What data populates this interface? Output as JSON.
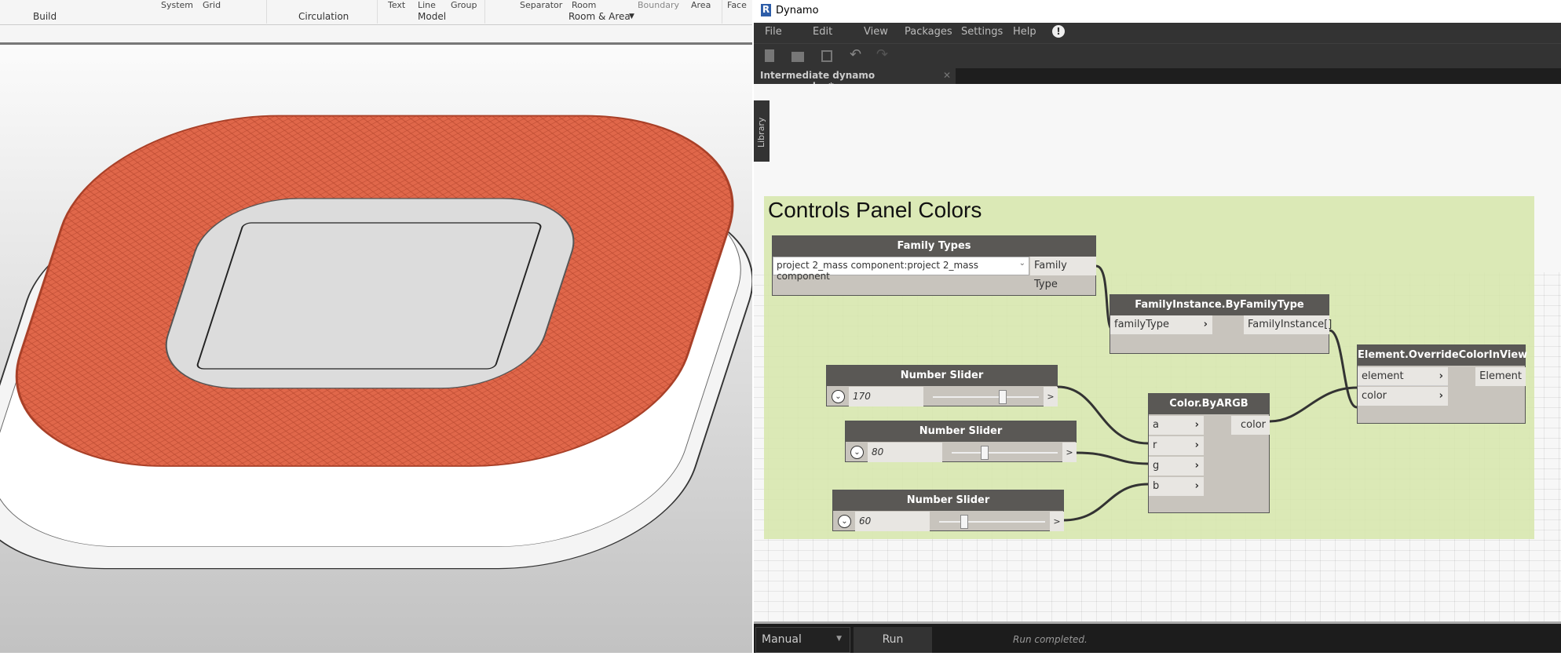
{
  "revit": {
    "ribbon_top": [
      "System",
      "Grid",
      "Text",
      "Line",
      "Group",
      "Separator",
      "Room",
      "Boundary",
      "Area",
      "Face"
    ],
    "panels": [
      "Build",
      "Circulation",
      "Model",
      "Room & Area"
    ],
    "model_color": "#e0674a"
  },
  "dynamo": {
    "title": "Dynamo",
    "menu": [
      "File",
      "Edit",
      "View",
      "Packages",
      "Settings",
      "Help"
    ],
    "toolbar_icons": [
      "new-file-icon",
      "open-icon",
      "save-icon",
      "undo-icon",
      "redo-icon"
    ],
    "tab": "Intermediate dynamo program.dyn*",
    "library": "Library",
    "group_title": "Controls Panel Colors",
    "group_color": "#d6e6aa",
    "nodes": {
      "family_types": {
        "title": "Family Types",
        "value": "project 2_mass component:project 2_mass component",
        "output": "Family Type"
      },
      "family_instance": {
        "title": "FamilyInstance.ByFamilyType",
        "input": "familyType",
        "output": "FamilyInstance[]"
      },
      "override": {
        "title": "Element.OverrideColorInView",
        "inputs": [
          "element",
          "color"
        ],
        "output": "Element"
      },
      "argb": {
        "title": "Color.ByARGB",
        "inputs": [
          "a",
          "r",
          "g",
          "b"
        ],
        "output": "color"
      },
      "sliders": [
        {
          "title": "Number Slider",
          "value": "170",
          "fraction": 0.66
        },
        {
          "title": "Number Slider",
          "value": "80",
          "fraction": 0.31
        },
        {
          "title": "Number Slider",
          "value": "60",
          "fraction": 0.24
        }
      ]
    },
    "run_mode": "Manual",
    "run_label": "Run",
    "status": "Run completed."
  }
}
